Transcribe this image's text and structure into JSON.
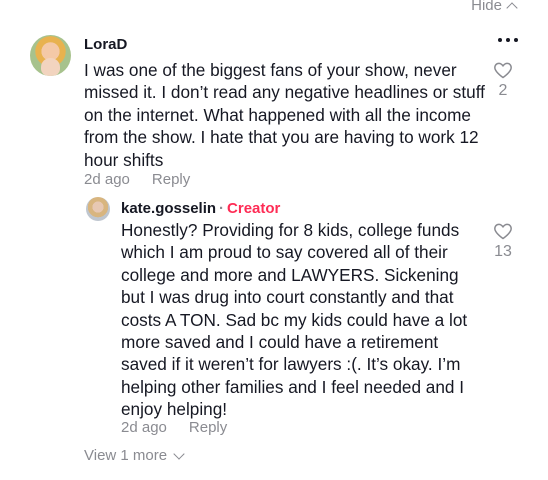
{
  "header": {
    "hide_label": "Hide"
  },
  "comment": {
    "author": "LoraD",
    "text": "I was one of the biggest fans of your show, never missed it. I don’t read any negative headlines or stuff on the internet. What happened with all the income from the show. I hate that you are having to work 12 hour shifts",
    "time": "2d ago",
    "reply_label": "Reply",
    "likes": "2",
    "icons": {
      "avatar": "avatar",
      "more": "more-icon",
      "like": "heart-icon"
    }
  },
  "reply": {
    "author": "kate.gosselin",
    "separator": "·",
    "badge": "Creator",
    "text": "Honestly? Providing for 8 kids, college funds which I am proud to say covered all of their college and more and LAWYERS. Sickening but I was drug into court constantly and that costs A TON. Sad bc my kids could have a lot more saved and I could have a retirement saved if it weren’t for lawyers :(. It’s okay. I’m helping other families and I feel needed and I enjoy helping!",
    "time": "2d ago",
    "reply_label": "Reply",
    "likes": "13",
    "icons": {
      "avatar": "avatar",
      "like": "heart-icon"
    }
  },
  "footer": {
    "view_more_label": "View 1 more"
  },
  "colors": {
    "text": "#161823",
    "muted": "#8a8b91",
    "creator_accent": "#fe2c55",
    "background": "#ffffff"
  }
}
